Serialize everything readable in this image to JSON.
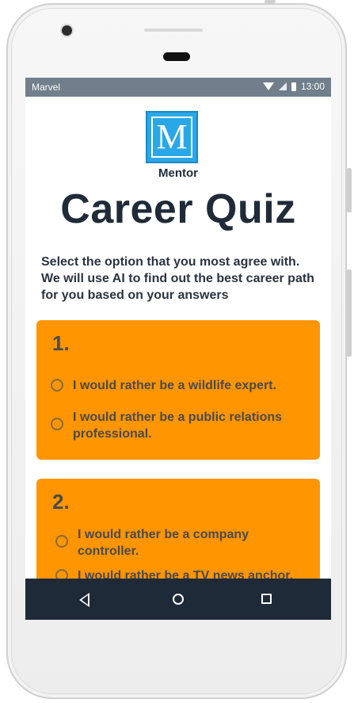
{
  "status_bar": {
    "carrier": "Marvel",
    "time": "13:00",
    "icons": [
      "wifi-icon",
      "signal-icon",
      "battery-icon"
    ]
  },
  "app": {
    "logo_letter": "M",
    "brand": "Mentor",
    "title": "Career Quiz",
    "intro": "Select the option that you most agree with. We will use AI to find out the best career path for you based on your answers"
  },
  "questions": [
    {
      "number": "1.",
      "options": [
        "I would rather be a wildlife expert.",
        "I would rather be a public relations professional."
      ]
    },
    {
      "number": "2.",
      "options": [
        "I would rather be a company controller.",
        "I would rather be a TV news anchor."
      ]
    }
  ],
  "navbar": {
    "icons": [
      "back-icon",
      "home-icon",
      "recent-apps-icon"
    ]
  },
  "colors": {
    "accent": "#ff9500",
    "title": "#1f2b38",
    "navbar": "#1e2a38",
    "status_bar": "#707f8b",
    "logo": "#29a8e8"
  }
}
